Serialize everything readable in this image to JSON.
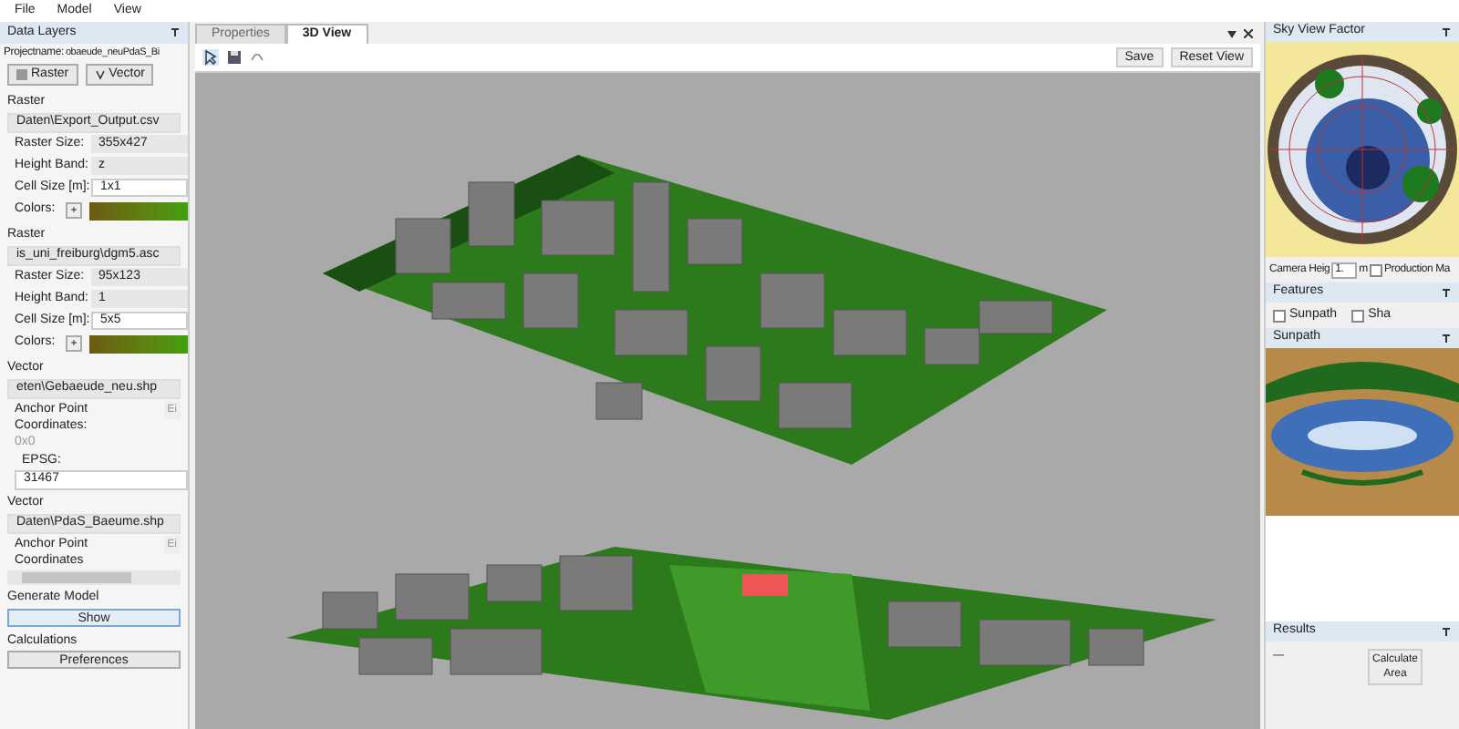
{
  "menu": [
    "File",
    "Model",
    "View"
  ],
  "left_panel": {
    "title": "Data Layers",
    "projectname_label": "Projectname:",
    "projectname_value": "obaeude_neuPdaS_Bi",
    "buttons": [
      "Raster",
      "Vector"
    ],
    "layers": [
      {
        "kind": "raster",
        "heading": "Raster",
        "file": "Daten\\Export_Output.csv",
        "fields": [
          {
            "label": "Raster Size:",
            "value": "355x427"
          },
          {
            "label": "Height Band:",
            "value": "z"
          },
          {
            "label": "Cell Size [m]:",
            "value": "1x1",
            "editable": true
          }
        ],
        "colors_label": "Colors:",
        "colors_button": "+"
      },
      {
        "kind": "raster",
        "heading": "Raster",
        "file": "is_uni_freiburg\\dgm5.asc",
        "fields": [
          {
            "label": "Raster Size:",
            "value": "95x123"
          },
          {
            "label": "Height Band:",
            "value": "1"
          },
          {
            "label": "Cell Size [m]:",
            "value": "5x5",
            "editable": true
          }
        ],
        "colors_label": "Colors:",
        "colors_button": "+"
      },
      {
        "kind": "vector",
        "heading": "Vector",
        "file": "eten\\Gebaeude_neu.shp",
        "anchor_label": "Anchor Point Coordinates:",
        "anchor_value": "0x0",
        "anchor_button": "Ei",
        "epsg_label": "EPSG:",
        "epsg_value": "31467"
      },
      {
        "kind": "vector",
        "heading": "Vector",
        "file": "Daten\\PdaS_Baeume.shp",
        "anchor_label": "Anchor Point Coordinates",
        "anchor_button": "Ei"
      }
    ],
    "generate_label": "Generate Model",
    "show_button": "Show",
    "calculations_label": "Calculations",
    "preferences_button": "Preferences"
  },
  "tabs": [
    {
      "label": "Properties",
      "selected": false
    },
    {
      "label": "3D View",
      "selected": true
    }
  ],
  "view_buttons": [
    "Save",
    "Reset View"
  ],
  "right_panel": {
    "sky_title": "Sky View Factor",
    "camera_label": "Camera Heig",
    "camera_value": "1.",
    "camera_unit": "m",
    "production_label": "Production Ma",
    "production_checked": false,
    "features_title": "Features",
    "features": [
      {
        "label": "Sunpath",
        "checked": false
      },
      {
        "label": "Sha",
        "checked": false
      }
    ],
    "sunpath_title": "Sunpath",
    "results_title": "Results",
    "results_value": "—",
    "calculate_button": "Calculate Area"
  }
}
